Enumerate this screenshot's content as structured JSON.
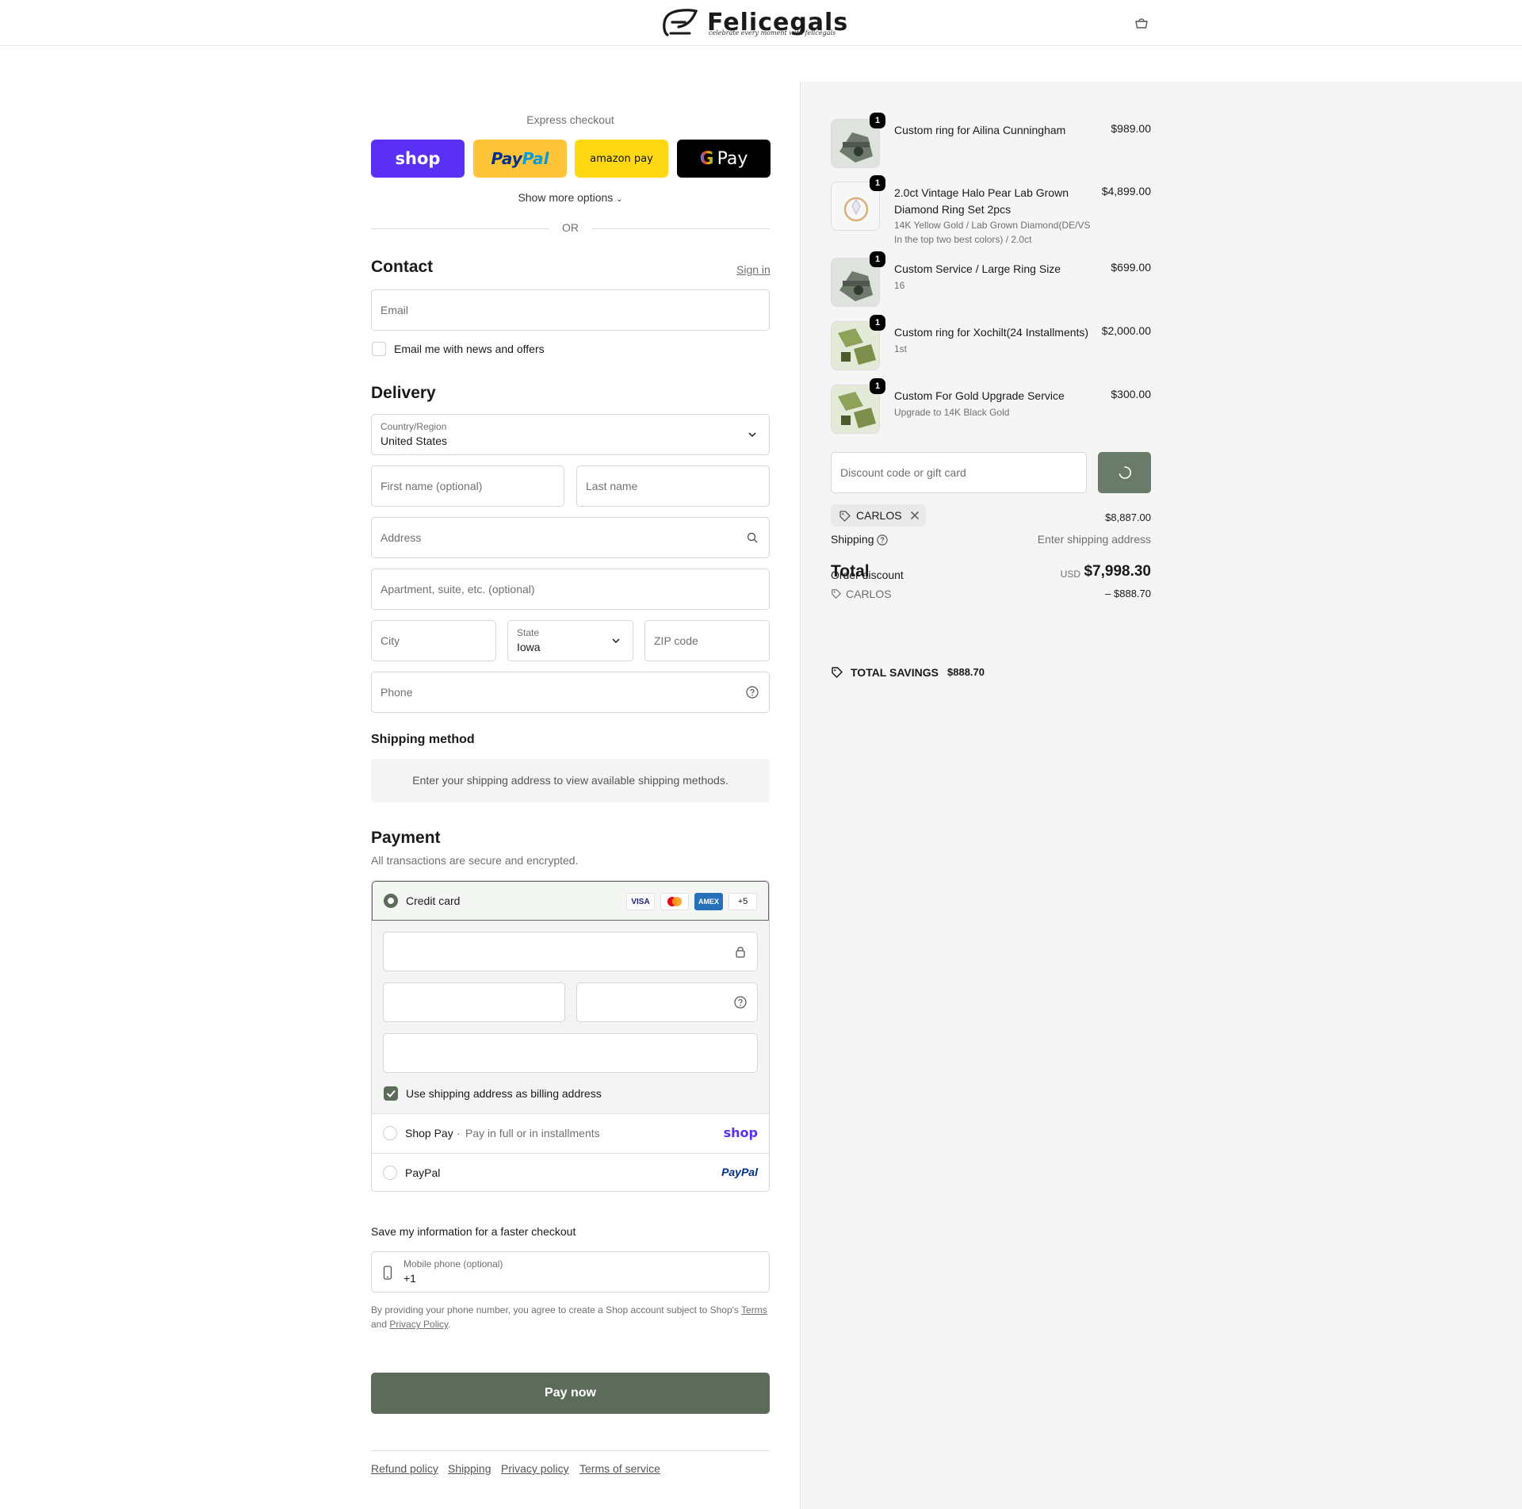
{
  "header": {
    "brand_name": "Felicegals",
    "brand_tagline": "celebrate every moment with felicegals",
    "cart_icon": "bag-icon"
  },
  "express": {
    "title": "Express checkout",
    "shop_label": "shop",
    "paypal_label_a": "Pay",
    "paypal_label_b": "Pal",
    "amazon_label": "amazon pay",
    "gpay_g": "G",
    "gpay_label": "Pay",
    "more_options": "Show more options",
    "or_text": "OR"
  },
  "contact": {
    "title": "Contact",
    "sign_in": "Sign in",
    "email_placeholder": "Email",
    "newsletter_label": "Email me with news and offers",
    "newsletter_checked": false
  },
  "delivery": {
    "title": "Delivery",
    "country_label": "Country/Region",
    "country_value": "United States",
    "first_name_placeholder": "First name (optional)",
    "last_name_placeholder": "Last name",
    "address_placeholder": "Address",
    "apartment_placeholder": "Apartment, suite, etc. (optional)",
    "city_placeholder": "City",
    "state_label": "State",
    "state_value": "Iowa",
    "zip_placeholder": "ZIP code",
    "phone_placeholder": "Phone"
  },
  "shipping_method": {
    "title": "Shipping method",
    "message": "Enter your shipping address to view available shipping methods."
  },
  "payment": {
    "title": "Payment",
    "subtitle": "All transactions are secure and encrypted.",
    "credit_card_label": "Credit card",
    "card_logos": [
      "VISA",
      "MC",
      "AMEX",
      "+5"
    ],
    "billing_same_label": "Use shipping address as billing address",
    "billing_same_checked": true,
    "shop_pay_label": "Shop Pay",
    "shop_pay_sep": "·",
    "shop_pay_desc": "Pay in full or in installments",
    "shop_pay_logo": "shop",
    "paypal_label": "PayPal",
    "paypal_logo": "PayPal"
  },
  "save_info": {
    "title": "Save my information for a faster checkout",
    "mobile_label": "Mobile phone (optional)",
    "mobile_value": "+1",
    "legal_prefix": "By providing your phone number, you agree to create a Shop account subject to Shop's",
    "legal_terms": "Terms",
    "legal_and": "and",
    "legal_privacy": "Privacy Policy",
    "legal_period": "."
  },
  "pay_now": "Pay now",
  "footer": {
    "links": [
      "Refund policy",
      "Shipping",
      "Privacy policy",
      "Terms of service"
    ]
  },
  "order": {
    "items": [
      {
        "name": "Custom ring for Ailina Cunningham",
        "price": "$989.00",
        "qty": "1",
        "details": []
      },
      {
        "name": "2.0ct Vintage Halo Pear Lab Grown Diamond Ring Set 2pcs",
        "price": "$4,899.00",
        "qty": "1",
        "details": [
          "14K Yellow Gold / Lab Grown Diamond(DE/VS",
          "In the top two best colors) / 2.0ct"
        ]
      },
      {
        "name": "Custom Service / Large Ring Size",
        "price": "$699.00",
        "qty": "1",
        "details": [
          "16"
        ]
      },
      {
        "name": "Custom ring for Xochilt(24 Installments)",
        "price": "$2,000.00",
        "qty": "1",
        "details": [
          "1st"
        ]
      },
      {
        "name": "Custom For Gold Upgrade Service",
        "price": "$300.00",
        "qty": "1",
        "details": [
          "Upgrade to 14K Black Gold"
        ]
      }
    ],
    "discount_placeholder": "Discount code or gift card",
    "applied_code": "CARLOS",
    "subtotal_value": "$8,887.00",
    "shipping_label": "Shipping",
    "shipping_value": "Enter shipping address",
    "total_label": "Total",
    "order_discount_label": "Order discount",
    "total_currency": "USD",
    "total_value": "$7,998.30",
    "discount_code_line": "CARLOS",
    "discount_amount": "– $888.70",
    "savings_label": "TOTAL SAVINGS",
    "savings_value": "$888.70"
  },
  "colors": {
    "accent": "#5d6b5b",
    "shop_pay": "#5a31f4",
    "paypal": "#ffc439",
    "amazon": "#ffd814"
  }
}
